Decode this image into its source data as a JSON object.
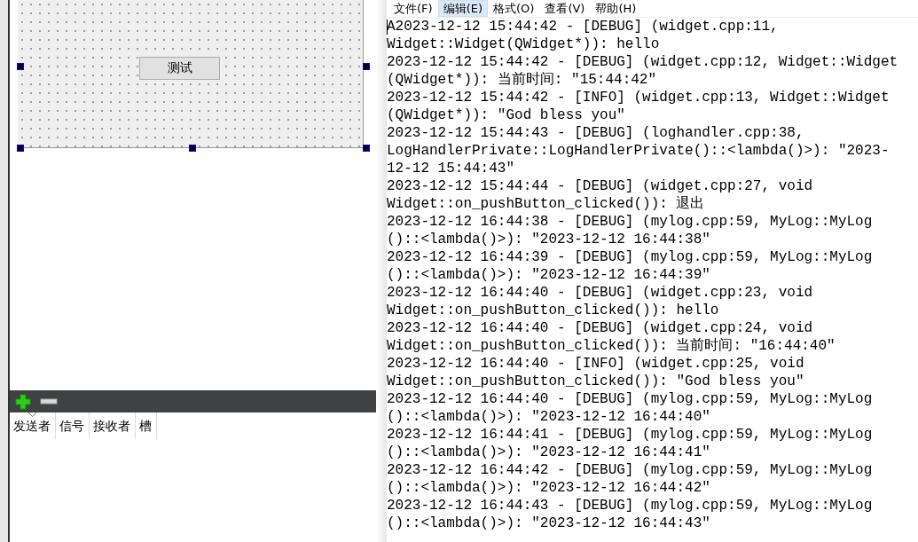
{
  "form": {
    "button": "测试"
  },
  "signal_slot_editor": {
    "columns": [
      {
        "label": "发送者",
        "sorted": true
      },
      {
        "label": "信号",
        "sorted": false
      },
      {
        "label": "接收者",
        "sorted": false
      },
      {
        "label": "槽",
        "sorted": false
      }
    ]
  },
  "menu": [
    {
      "label": "文件(F)",
      "selected": false
    },
    {
      "label": "编辑(E)",
      "selected": true
    },
    {
      "label": "格式(O)",
      "selected": false
    },
    {
      "label": "查看(V)",
      "selected": false
    },
    {
      "label": "帮助(H)",
      "selected": false
    }
  ],
  "log_lines": [
    "A2023-12-12 15:44:42 - [DEBUG] (widget.cpp:11,",
    "Widget::Widget(QWidget*)): hello",
    "2023-12-12 15:44:42 - [DEBUG] (widget.cpp:12, Widget::Widget",
    "(QWidget*)): 当前时间: \"15:44:42\"",
    "2023-12-12 15:44:42 - [INFO] (widget.cpp:13, Widget::Widget",
    "(QWidget*)): \"God bless you\"",
    "2023-12-12 15:44:43 - [DEBUG] (loghandler.cpp:38,",
    "LogHandlerPrivate::LogHandlerPrivate()::<lambda()>): \"2023-",
    "12-12 15:44:43\"",
    "2023-12-12 15:44:44 - [DEBUG] (widget.cpp:27, void",
    "Widget::on_pushButton_clicked()): 退出",
    "2023-12-12 16:44:38 - [DEBUG] (mylog.cpp:59, MyLog::MyLog",
    "()::<lambda()>): \"2023-12-12 16:44:38\"",
    "2023-12-12 16:44:39 - [DEBUG] (mylog.cpp:59, MyLog::MyLog",
    "()::<lambda()>): \"2023-12-12 16:44:39\"",
    "2023-12-12 16:44:40 - [DEBUG] (widget.cpp:23, void",
    "Widget::on_pushButton_clicked()): hello",
    "2023-12-12 16:44:40 - [DEBUG] (widget.cpp:24, void",
    "Widget::on_pushButton_clicked()): 当前时间: \"16:44:40\"",
    "2023-12-12 16:44:40 - [INFO] (widget.cpp:25, void",
    "Widget::on_pushButton_clicked()): \"God bless you\"",
    "2023-12-12 16:44:40 - [DEBUG] (mylog.cpp:59, MyLog::MyLog",
    "()::<lambda()>): \"2023-12-12 16:44:40\"",
    "2023-12-12 16:44:41 - [DEBUG] (mylog.cpp:59, MyLog::MyLog",
    "()::<lambda()>): \"2023-12-12 16:44:41\"",
    "2023-12-12 16:44:42 - [DEBUG] (mylog.cpp:59, MyLog::MyLog",
    "()::<lambda()>): \"2023-12-12 16:44:42\"",
    "2023-12-12 16:44:43 - [DEBUG] (mylog.cpp:59, MyLog::MyLog",
    "()::<lambda()>): \"2023-12-12 16:44:43\""
  ]
}
